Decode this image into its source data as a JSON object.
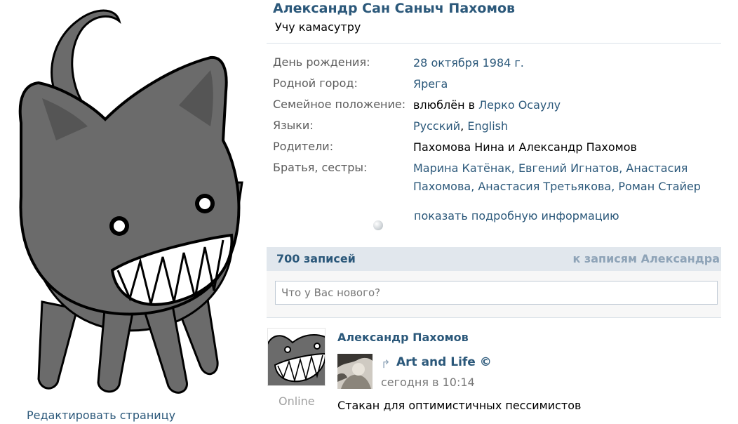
{
  "profile": {
    "name": "Александр Сан Саныч Пахомов",
    "status": "Учу камасутру",
    "edit_link": "Редактировать страницу"
  },
  "info": {
    "birthday_label": "День рождения:",
    "birthday_value": "28 октября 1984 г.",
    "hometown_label": "Родной город:",
    "hometown_value": "Ярега",
    "family_label": "Семейное положение:",
    "family_prefix": "влюблён в",
    "family_person": "Лерко Осаулу",
    "languages_label": "Языки:",
    "language_1": "Русский",
    "language_sep": ",",
    "language_2": "English",
    "parents_label": "Родители:",
    "parents_value": "Пахомова Нина и Александр Пахомов",
    "siblings_label": "Братья, сестры:",
    "siblings_line1": "Марина Катёнак, Евгений Игнатов, Анастасия",
    "siblings_line2": "Пахомова, Анастасия Третьякова, Роман Стайер",
    "show_more": "показать подробную информацию"
  },
  "wall": {
    "count": "700 записей",
    "to_posts": "к записям Александра",
    "input_placeholder": "Что у Вас нового?"
  },
  "post": {
    "author": "Александр Пахомов",
    "online": "Online",
    "repost_icon": "repost-arrow-icon",
    "repost_source": "Art and Life ©",
    "time": "сегодня в 10:14",
    "text": "Стакан для оптимистичных пессимистов"
  },
  "colors": {
    "link": "#2b587a",
    "label": "#5b5b5b",
    "wall_bar": "#e1e7ed",
    "muted_link": "#8ea3b7",
    "cat_body": "#6b6b6b"
  }
}
